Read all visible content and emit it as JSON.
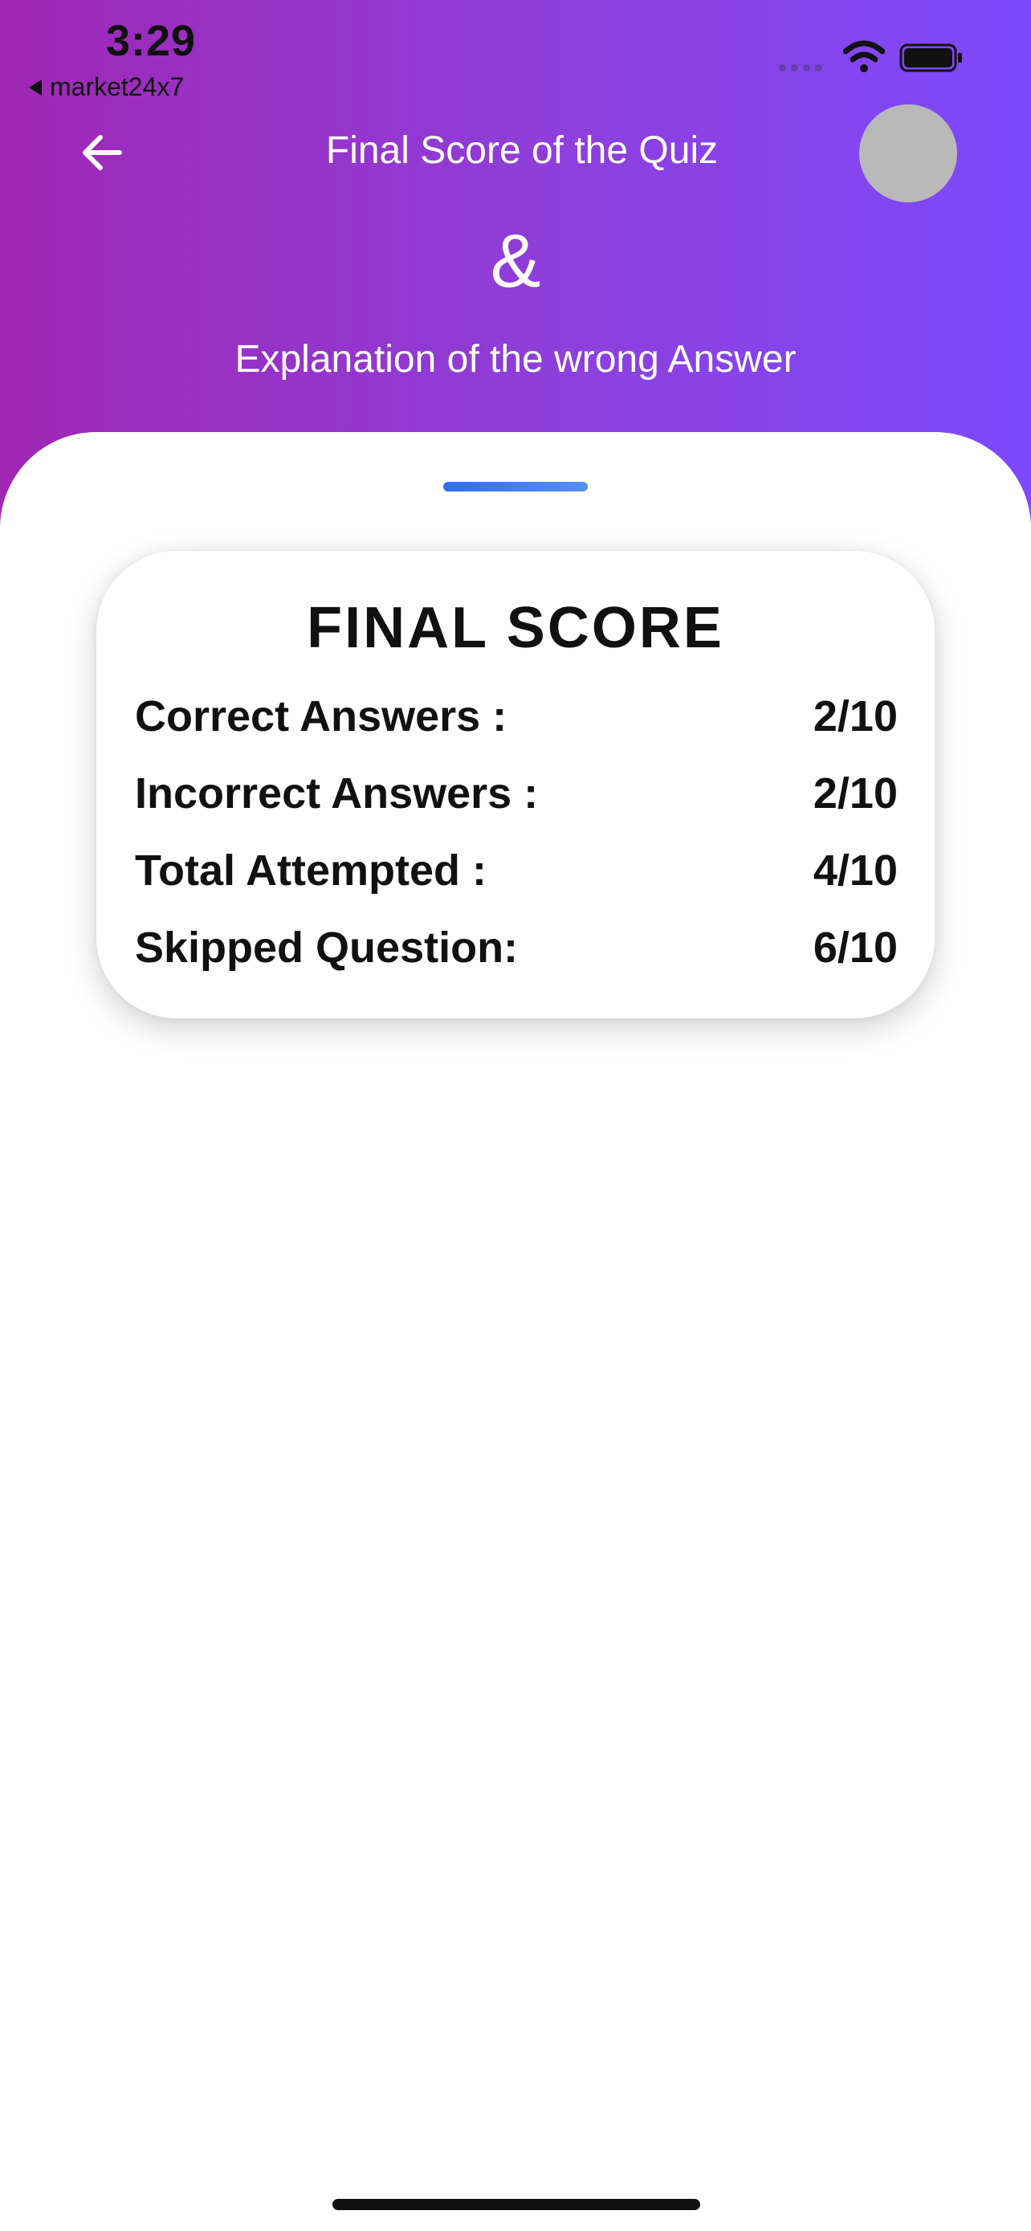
{
  "status_bar": {
    "time": "3:29",
    "back_app": "market24x7"
  },
  "nav": {
    "title": "Final Score of the Quiz"
  },
  "header": {
    "ampersand": "&",
    "subtitle": "Explanation of the wrong Answer"
  },
  "card": {
    "title": "FINAL SCORE",
    "rows": [
      {
        "label": "Correct Answers :",
        "value": "2/10"
      },
      {
        "label": "Incorrect Answers :",
        "value": "2/10"
      },
      {
        "label": "Total Attempted :",
        "value": "4/10"
      },
      {
        "label": "Skipped Question:",
        "value": "6/10"
      }
    ]
  },
  "icons": {
    "back": "arrow-left-icon",
    "wifi": "wifi-icon",
    "battery": "battery-icon",
    "avatar": "avatar"
  },
  "colors": {
    "header_gradient_start": "#9f27b4",
    "header_gradient_end": "#7d49fc",
    "handle": "#2f6df0",
    "avatar": "#b9b9b9"
  }
}
